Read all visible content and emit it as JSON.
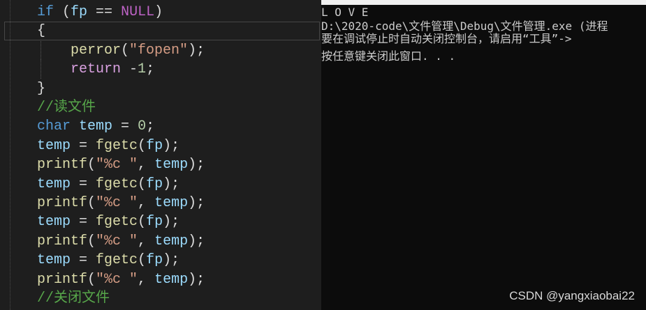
{
  "editor": {
    "lines": [
      [
        {
          "t": "if",
          "c": "kw"
        },
        {
          "t": " (",
          "c": "punc"
        },
        {
          "t": "fp",
          "c": "var"
        },
        {
          "t": " == ",
          "c": "punc"
        },
        {
          "t": "NULL",
          "c": "macro"
        },
        {
          "t": ")",
          "c": "punc"
        }
      ],
      [
        {
          "t": "{",
          "c": "punc"
        }
      ],
      [
        {
          "t": "    ",
          "c": "punc"
        },
        {
          "t": "perror",
          "c": "fn"
        },
        {
          "t": "(",
          "c": "punc"
        },
        {
          "t": "\"fopen\"",
          "c": "str"
        },
        {
          "t": ");",
          "c": "punc"
        }
      ],
      [
        {
          "t": "    ",
          "c": "punc"
        },
        {
          "t": "return",
          "c": "kwc"
        },
        {
          "t": " -",
          "c": "punc"
        },
        {
          "t": "1",
          "c": "num"
        },
        {
          "t": ";",
          "c": "punc"
        }
      ],
      [
        {
          "t": "}",
          "c": "punc"
        }
      ],
      [
        {
          "t": "//读文件",
          "c": "cmt"
        }
      ],
      [
        {
          "t": "char",
          "c": "kw"
        },
        {
          "t": " ",
          "c": "punc"
        },
        {
          "t": "temp",
          "c": "var"
        },
        {
          "t": " = ",
          "c": "punc"
        },
        {
          "t": "0",
          "c": "num"
        },
        {
          "t": ";",
          "c": "punc"
        }
      ],
      [
        {
          "t": "temp",
          "c": "var"
        },
        {
          "t": " = ",
          "c": "punc"
        },
        {
          "t": "fgetc",
          "c": "fn"
        },
        {
          "t": "(",
          "c": "punc"
        },
        {
          "t": "fp",
          "c": "var"
        },
        {
          "t": ");",
          "c": "punc"
        }
      ],
      [
        {
          "t": "printf",
          "c": "fn"
        },
        {
          "t": "(",
          "c": "punc"
        },
        {
          "t": "\"%c \"",
          "c": "str"
        },
        {
          "t": ", ",
          "c": "punc"
        },
        {
          "t": "temp",
          "c": "var"
        },
        {
          "t": ");",
          "c": "punc"
        }
      ],
      [
        {
          "t": "temp",
          "c": "var"
        },
        {
          "t": " = ",
          "c": "punc"
        },
        {
          "t": "fgetc",
          "c": "fn"
        },
        {
          "t": "(",
          "c": "punc"
        },
        {
          "t": "fp",
          "c": "var"
        },
        {
          "t": ");",
          "c": "punc"
        }
      ],
      [
        {
          "t": "printf",
          "c": "fn"
        },
        {
          "t": "(",
          "c": "punc"
        },
        {
          "t": "\"%c \"",
          "c": "str"
        },
        {
          "t": ", ",
          "c": "punc"
        },
        {
          "t": "temp",
          "c": "var"
        },
        {
          "t": ");",
          "c": "punc"
        }
      ],
      [
        {
          "t": "temp",
          "c": "var"
        },
        {
          "t": " = ",
          "c": "punc"
        },
        {
          "t": "fgetc",
          "c": "fn"
        },
        {
          "t": "(",
          "c": "punc"
        },
        {
          "t": "fp",
          "c": "var"
        },
        {
          "t": ");",
          "c": "punc"
        }
      ],
      [
        {
          "t": "printf",
          "c": "fn"
        },
        {
          "t": "(",
          "c": "punc"
        },
        {
          "t": "\"%c \"",
          "c": "str"
        },
        {
          "t": ", ",
          "c": "punc"
        },
        {
          "t": "temp",
          "c": "var"
        },
        {
          "t": ");",
          "c": "punc"
        }
      ],
      [
        {
          "t": "temp",
          "c": "var"
        },
        {
          "t": " = ",
          "c": "punc"
        },
        {
          "t": "fgetc",
          "c": "fn"
        },
        {
          "t": "(",
          "c": "punc"
        },
        {
          "t": "fp",
          "c": "var"
        },
        {
          "t": ");",
          "c": "punc"
        }
      ],
      [
        {
          "t": "printf",
          "c": "fn"
        },
        {
          "t": "(",
          "c": "punc"
        },
        {
          "t": "\"%c \"",
          "c": "str"
        },
        {
          "t": ", ",
          "c": "punc"
        },
        {
          "t": "temp",
          "c": "var"
        },
        {
          "t": ");",
          "c": "punc"
        }
      ],
      [
        {
          "t": "//关闭文件",
          "c": "cmt"
        }
      ]
    ]
  },
  "console": {
    "lines": [
      "L O V E",
      "D:\\2020-code\\文件管理\\Debug\\文件管理.exe (进程",
      "要在调试停止时自动关闭控制台，请启用“工具”->",
      "按任意键关闭此窗口. . ."
    ]
  },
  "watermark": "CSDN @yangxiaobai22",
  "colors": {
    "editor_bg": "#1e1e1e",
    "console_bg": "#0c0c0c",
    "keyword": "#569cd6",
    "control_keyword": "#d8a0df",
    "variable": "#9cdcfe",
    "function": "#dcdcaa",
    "string": "#d69d85",
    "number": "#b5cea8",
    "comment": "#57a64a",
    "macro": "#bd63c5"
  }
}
